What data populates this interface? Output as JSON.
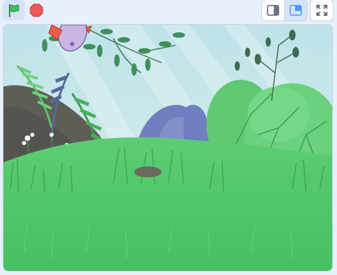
{
  "toolbar": {
    "buttons": [
      {
        "name": "green-flag",
        "icon": "green-flag-icon"
      },
      {
        "name": "stop",
        "icon": "stop-sign-icon"
      },
      {
        "name": "small-stage",
        "icon": "small-stage-icon"
      },
      {
        "name": "normal-stage",
        "icon": "normal-stage-icon",
        "selected": true
      },
      {
        "name": "full-screen",
        "icon": "full-screen-icon"
      }
    ]
  },
  "stage": {
    "backdrop": "forest-meadow",
    "sprites": [
      "cartoon-bird"
    ]
  },
  "colors": {
    "flag_green": "#3dbf5a",
    "stop_red": "#ec5959",
    "accent_blue": "#4c97ff",
    "grass": "#4fc76a"
  }
}
